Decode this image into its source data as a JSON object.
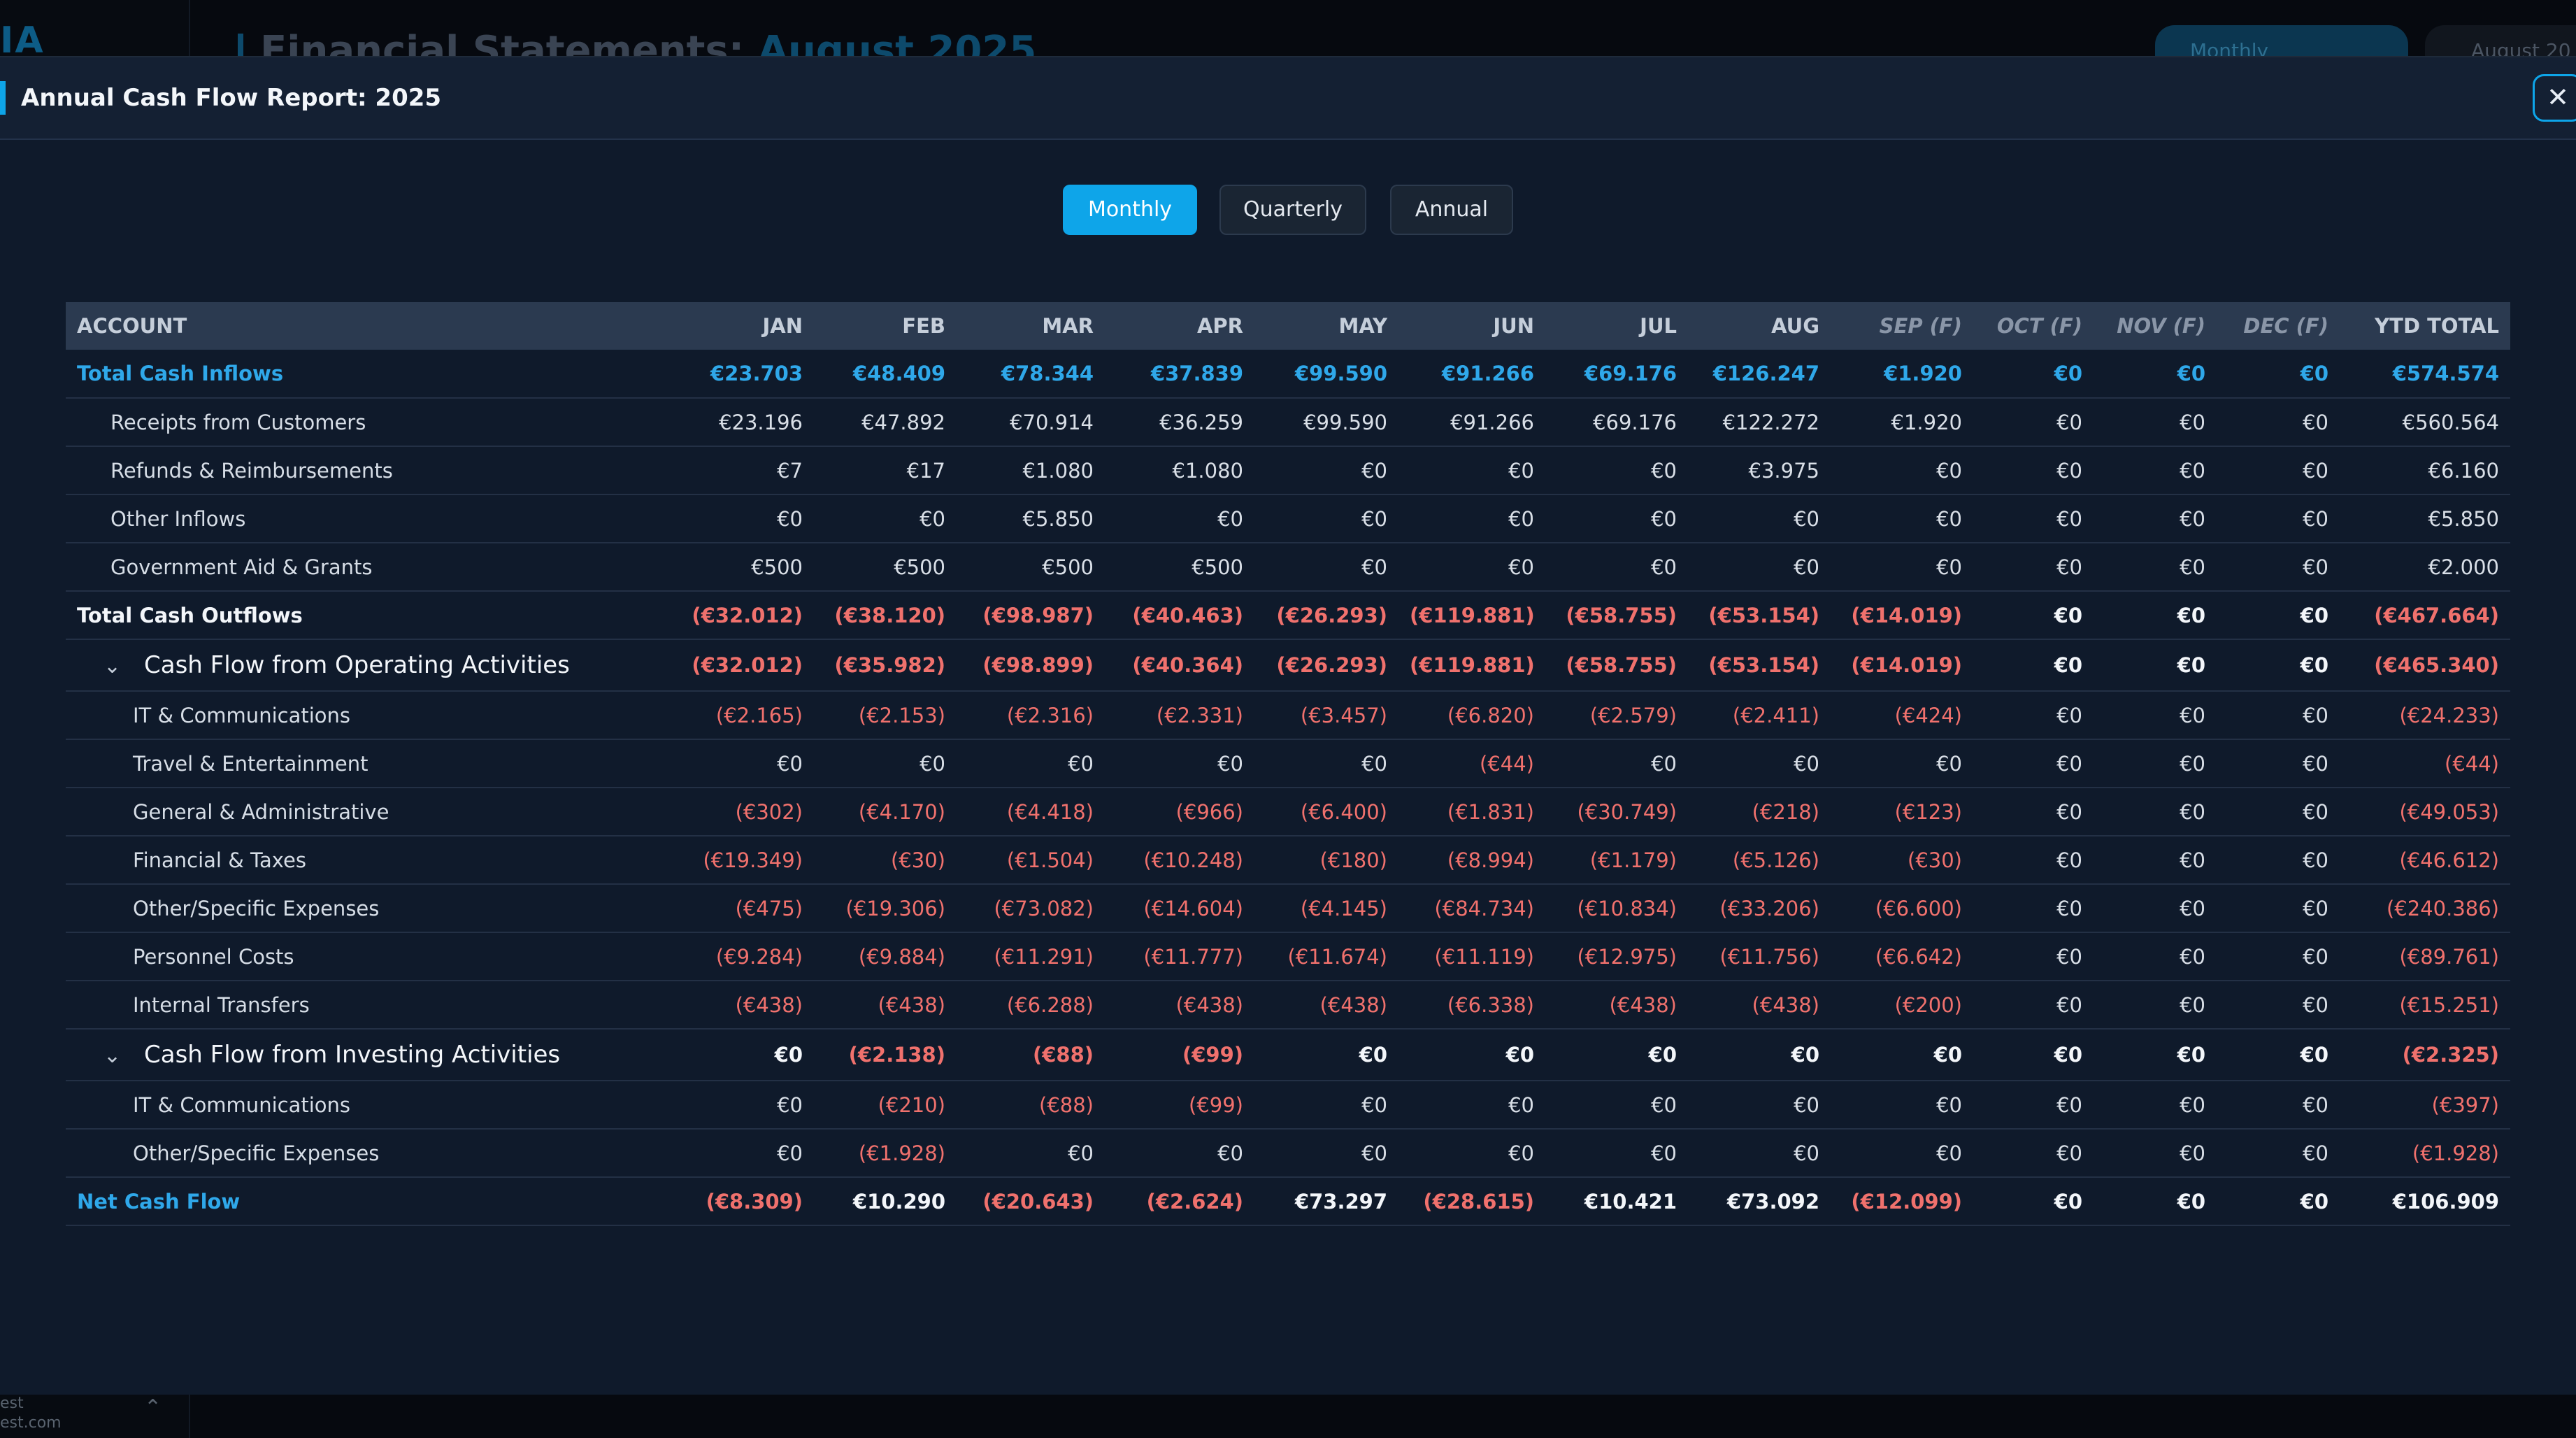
{
  "background": {
    "logo": "IA",
    "page_title": "Financial Statements:",
    "page_title_accent": "August 2025",
    "period_button": "Monthly",
    "month_button": "August 20",
    "footer_line1": "est",
    "footer_line2": "est.com"
  },
  "modal": {
    "title": "Annual Cash Flow Report: 2025",
    "close_label": "✕",
    "toggles": [
      "Monthly",
      "Quarterly",
      "Annual"
    ],
    "active_toggle": "Monthly"
  },
  "colors": {
    "accent": "#0ea5e9",
    "negative": "#f0716d",
    "inflow": "#2fa8ea"
  },
  "table": {
    "headers": [
      "ACCOUNT",
      "JAN",
      "FEB",
      "MAR",
      "APR",
      "MAY",
      "JUN",
      "JUL",
      "AUG",
      "SEP (F)",
      "OCT (F)",
      "NOV (F)",
      "DEC (F)",
      "YTD TOTAL"
    ],
    "rows": [
      {
        "type": "inflow_total",
        "label": "Total Cash Inflows",
        "values": [
          "€23.703",
          "€48.409",
          "€78.344",
          "€37.839",
          "€99.590",
          "€91.266",
          "€69.176",
          "€126.247",
          "€1.920",
          "€0",
          "€0",
          "€0",
          "€574.574"
        ]
      },
      {
        "type": "lvl1",
        "label": "Receipts from Customers",
        "values": [
          "€23.196",
          "€47.892",
          "€70.914",
          "€36.259",
          "€99.590",
          "€91.266",
          "€69.176",
          "€122.272",
          "€1.920",
          "€0",
          "€0",
          "€0",
          "€560.564"
        ]
      },
      {
        "type": "lvl1",
        "label": "Refunds & Reimbursements",
        "values": [
          "€7",
          "€17",
          "€1.080",
          "€1.080",
          "€0",
          "€0",
          "€0",
          "€3.975",
          "€0",
          "€0",
          "€0",
          "€0",
          "€6.160"
        ]
      },
      {
        "type": "lvl1",
        "label": "Other Inflows",
        "values": [
          "€0",
          "€0",
          "€5.850",
          "€0",
          "€0",
          "€0",
          "€0",
          "€0",
          "€0",
          "€0",
          "€0",
          "€0",
          "€5.850"
        ]
      },
      {
        "type": "lvl1",
        "label": "Government Aid & Grants",
        "values": [
          "€500",
          "€500",
          "€500",
          "€500",
          "€0",
          "€0",
          "€0",
          "€0",
          "€0",
          "€0",
          "€0",
          "€0",
          "€2.000"
        ]
      },
      {
        "type": "outflow_total",
        "label": "Total Cash Outflows",
        "values": [
          "(€32.012)",
          "(€38.120)",
          "(€98.987)",
          "(€40.463)",
          "(€26.293)",
          "(€119.881)",
          "(€58.755)",
          "(€53.154)",
          "(€14.019)",
          "€0",
          "€0",
          "€0",
          "(€467.664)"
        ]
      },
      {
        "type": "sub",
        "label": "Cash Flow from Operating Activities",
        "values": [
          "(€32.012)",
          "(€35.982)",
          "(€98.899)",
          "(€40.364)",
          "(€26.293)",
          "(€119.881)",
          "(€58.755)",
          "(€53.154)",
          "(€14.019)",
          "€0",
          "€0",
          "€0",
          "(€465.340)"
        ]
      },
      {
        "type": "lvl2",
        "label": "IT & Communications",
        "values": [
          "(€2.165)",
          "(€2.153)",
          "(€2.316)",
          "(€2.331)",
          "(€3.457)",
          "(€6.820)",
          "(€2.579)",
          "(€2.411)",
          "(€424)",
          "€0",
          "€0",
          "€0",
          "(€24.233)"
        ]
      },
      {
        "type": "lvl2",
        "label": "Travel & Entertainment",
        "values": [
          "€0",
          "€0",
          "€0",
          "€0",
          "€0",
          "(€44)",
          "€0",
          "€0",
          "€0",
          "€0",
          "€0",
          "€0",
          "(€44)"
        ]
      },
      {
        "type": "lvl2",
        "label": "General & Administrative",
        "values": [
          "(€302)",
          "(€4.170)",
          "(€4.418)",
          "(€966)",
          "(€6.400)",
          "(€1.831)",
          "(€30.749)",
          "(€218)",
          "(€123)",
          "€0",
          "€0",
          "€0",
          "(€49.053)"
        ]
      },
      {
        "type": "lvl2",
        "label": "Financial & Taxes",
        "values": [
          "(€19.349)",
          "(€30)",
          "(€1.504)",
          "(€10.248)",
          "(€180)",
          "(€8.994)",
          "(€1.179)",
          "(€5.126)",
          "(€30)",
          "€0",
          "€0",
          "€0",
          "(€46.612)"
        ]
      },
      {
        "type": "lvl2",
        "label": "Other/Specific Expenses",
        "values": [
          "(€475)",
          "(€19.306)",
          "(€73.082)",
          "(€14.604)",
          "(€4.145)",
          "(€84.734)",
          "(€10.834)",
          "(€33.206)",
          "(€6.600)",
          "€0",
          "€0",
          "€0",
          "(€240.386)"
        ]
      },
      {
        "type": "lvl2",
        "label": "Personnel Costs",
        "values": [
          "(€9.284)",
          "(€9.884)",
          "(€11.291)",
          "(€11.777)",
          "(€11.674)",
          "(€11.119)",
          "(€12.975)",
          "(€11.756)",
          "(€6.642)",
          "€0",
          "€0",
          "€0",
          "(€89.761)"
        ]
      },
      {
        "type": "lvl2",
        "label": "Internal Transfers",
        "values": [
          "(€438)",
          "(€438)",
          "(€6.288)",
          "(€438)",
          "(€438)",
          "(€6.338)",
          "(€438)",
          "(€438)",
          "(€200)",
          "€0",
          "€0",
          "€0",
          "(€15.251)"
        ]
      },
      {
        "type": "sub",
        "label": "Cash Flow from Investing Activities",
        "values": [
          "€0",
          "(€2.138)",
          "(€88)",
          "(€99)",
          "€0",
          "€0",
          "€0",
          "€0",
          "€0",
          "€0",
          "€0",
          "€0",
          "(€2.325)"
        ]
      },
      {
        "type": "lvl2",
        "label": "IT & Communications",
        "values": [
          "€0",
          "(€210)",
          "(€88)",
          "(€99)",
          "€0",
          "€0",
          "€0",
          "€0",
          "€0",
          "€0",
          "€0",
          "€0",
          "(€397)"
        ]
      },
      {
        "type": "lvl2",
        "label": "Other/Specific Expenses",
        "values": [
          "€0",
          "(€1.928)",
          "€0",
          "€0",
          "€0",
          "€0",
          "€0",
          "€0",
          "€0",
          "€0",
          "€0",
          "€0",
          "(€1.928)"
        ]
      },
      {
        "type": "net",
        "label": "Net Cash Flow",
        "values": [
          "(€8.309)",
          "€10.290",
          "(€20.643)",
          "(€2.624)",
          "€73.297",
          "(€28.615)",
          "€10.421",
          "€73.092",
          "(€12.099)",
          "€0",
          "€0",
          "€0",
          "€106.909"
        ]
      }
    ]
  }
}
